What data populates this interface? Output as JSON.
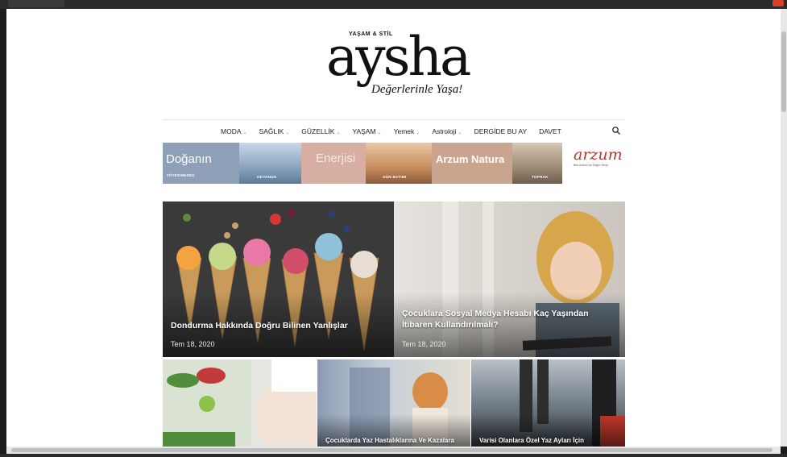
{
  "logo": {
    "prefix": "YAŞAM & STİL",
    "name": "aysha",
    "tagline": "Değerlerinle Yaşa!"
  },
  "nav": {
    "items": [
      {
        "label": "MODA",
        "dropdown": true
      },
      {
        "label": "SAĞLIK",
        "dropdown": true
      },
      {
        "label": "GÜZELLİK",
        "dropdown": true
      },
      {
        "label": "YAŞAM",
        "dropdown": true
      },
      {
        "label": "Yemek",
        "dropdown": true
      },
      {
        "label": "Astroloji",
        "dropdown": true
      },
      {
        "label": "DERGİDE BU AY",
        "dropdown": false
      },
      {
        "label": "DAVET",
        "dropdown": false
      }
    ],
    "search_icon": "search-icon"
  },
  "banner": {
    "word1": "Doğanın",
    "word2": "Enerjisi",
    "word3": "Arzum Natura",
    "sub1": "#ÖTESİNESEÇ",
    "sub2": "OKYANUS",
    "sub3": "GÜN BATIMI",
    "sub4": "TOPRAK",
    "brand": "arzum",
    "brand_sub": "Ben Arzum'um Değer Verşe"
  },
  "featured": [
    {
      "title": "Dondurma Hakkında Doğru Bilinen Yanlışlar",
      "date": "Tem 18, 2020"
    },
    {
      "title": "Çocuklara Sosyal Medya Hesabı Kaç Yaşından İtibaren Kullandırılmalı?",
      "date": "Tem 18, 2020"
    }
  ],
  "small": [
    {
      "title": ""
    },
    {
      "title": "Çocuklarda Yaz Hastalıklarına Ve Kazalara"
    },
    {
      "title": "Varisi Olanlara Özel Yaz Ayları İçin"
    }
  ],
  "colors": {
    "brand_red": "#c7302a",
    "text_dark": "#222222"
  }
}
